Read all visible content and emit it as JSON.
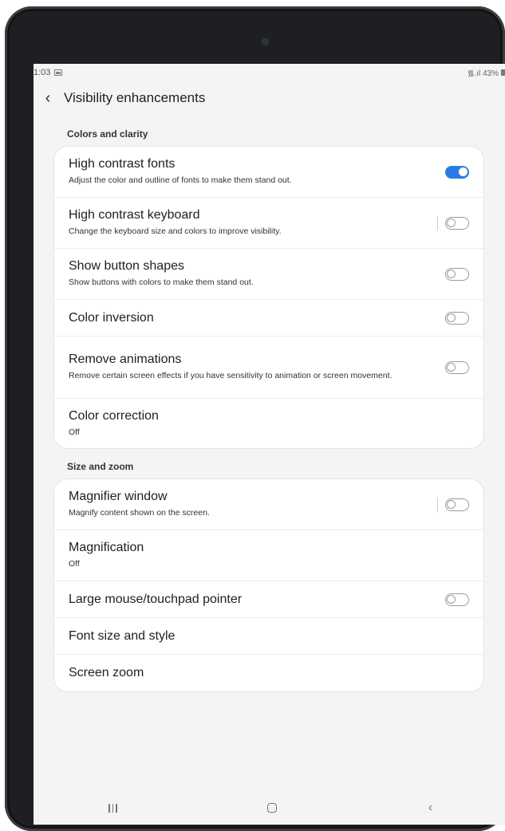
{
  "status_bar": {
    "time": "1:03",
    "right_text": "᯾.ıl 43%"
  },
  "header": {
    "title": "Visibility enhancements",
    "back_icon": "chevron-left-icon"
  },
  "sections": [
    {
      "label": "Colors and clarity",
      "items": [
        {
          "title": "High contrast fonts",
          "subtitle": "Adjust the color and outline of fonts to make them stand out.",
          "toggle": true,
          "on": true
        },
        {
          "title": "High contrast keyboard",
          "subtitle": "Change the keyboard size and colors to improve visibility.",
          "toggle": true,
          "on": false
        },
        {
          "title": "Show button shapes",
          "subtitle": "Show buttons with colors to make them stand out.",
          "toggle": true,
          "on": false
        },
        {
          "title": "Color inversion",
          "subtitle": "",
          "toggle": true,
          "on": false
        },
        {
          "title": "Remove animations",
          "subtitle": "Remove certain screen effects if you have sensitivity to animation or screen movement.",
          "toggle": true,
          "on": false
        },
        {
          "title": "Color correction",
          "subtitle": "Off",
          "toggle": false
        }
      ]
    },
    {
      "label": "Size and zoom",
      "items": [
        {
          "title": "Magnifier window",
          "subtitle": "Magnify content shown on the screen.",
          "toggle": true,
          "on": false
        },
        {
          "title": "Magnification",
          "subtitle": "Off",
          "toggle": false
        },
        {
          "title": "Large mouse/touchpad pointer",
          "subtitle": "",
          "toggle": true,
          "on": false
        },
        {
          "title": "Font size and style",
          "subtitle": "",
          "toggle": false
        },
        {
          "title": "Screen zoom",
          "subtitle": "",
          "toggle": false
        }
      ]
    }
  ],
  "nav_bar": {
    "recents_icon": "recents-icon",
    "home_icon": "home-icon",
    "back_icon": "back-icon"
  },
  "colors": {
    "accent": "#2a7be6",
    "background": "#f4f4f4",
    "card": "#ffffff",
    "bezel": "#1d1f22"
  }
}
